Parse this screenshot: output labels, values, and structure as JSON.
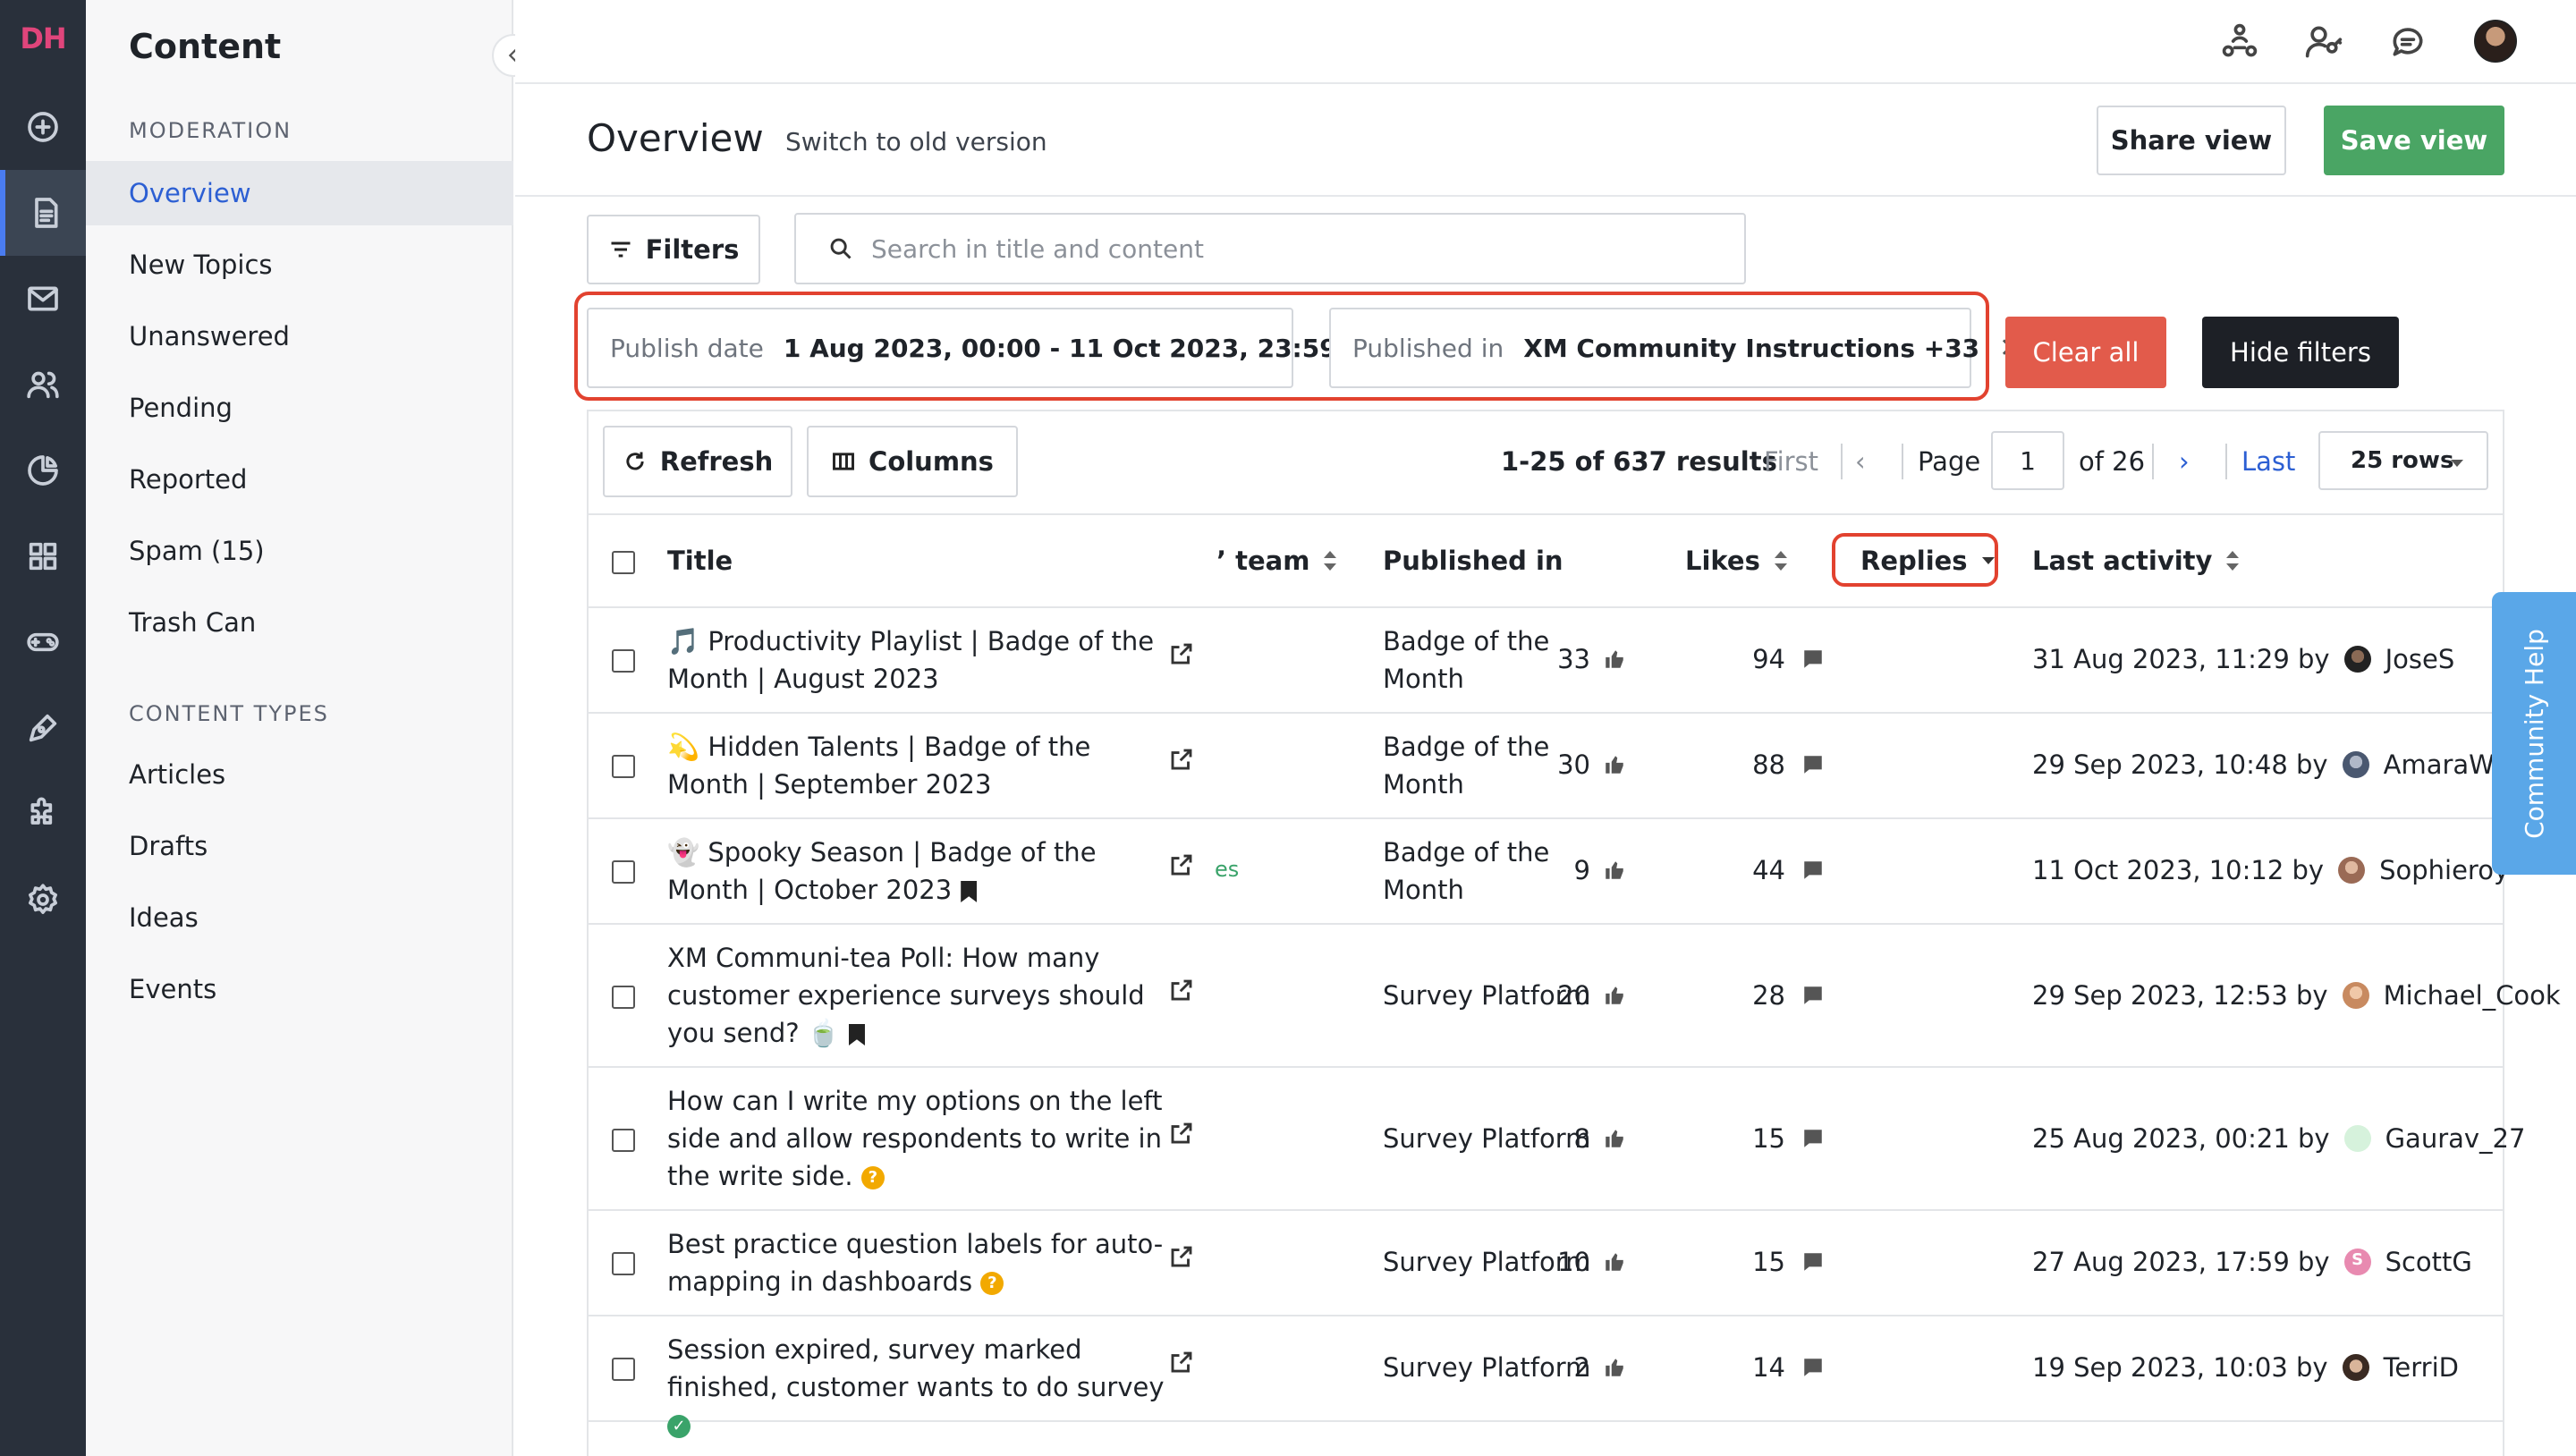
{
  "rail": {
    "logo": "DH"
  },
  "sidebar": {
    "title": "Content",
    "section_moderation": "MODERATION",
    "moderation_items": [
      "Overview",
      "New Topics",
      "Unanswered",
      "Pending",
      "Reported",
      "Spam (15)",
      "Trash Can"
    ],
    "section_types": "CONTENT TYPES",
    "type_items": [
      "Articles",
      "Drafts",
      "Ideas",
      "Events"
    ]
  },
  "header": {
    "title": "Overview",
    "old_version": "Switch to old version",
    "share": "Share view",
    "save": "Save view"
  },
  "filters": {
    "button": "Filters",
    "search_placeholder": "Search in title and content",
    "chip1_label": "Publish date",
    "chip1_value": "1 Aug 2023, 00:00 - 11 Oct 2023, 23:59",
    "chip2_label": "Published in",
    "chip2_value": "XM Community Instructions +33",
    "clear": "Clear all",
    "hide": "Hide filters"
  },
  "toolbar": {
    "refresh": "Refresh",
    "columns": "Columns",
    "results": "1-25 of 637 results",
    "first": "First",
    "page_label": "Page",
    "page_value": "1",
    "of": "of 26",
    "last": "Last",
    "rows": "25 rows"
  },
  "columns": {
    "title": "Title",
    "team": "’ team",
    "published_in": "Published in",
    "likes": "Likes",
    "replies": "Replies",
    "last_activity": "Last activity"
  },
  "rows": [
    {
      "title": "🎵 Productivity Playlist | Badge of the Month | August 2023",
      "pub": "Badge of the Month",
      "likes": "33",
      "replies": "94",
      "activity": "31 Aug 2023, 11:29 by",
      "user": "JoseS"
    },
    {
      "title": "💫 Hidden Talents | Badge of the Month | September 2023",
      "pub": "Badge of the Month",
      "likes": "30",
      "replies": "88",
      "activity": "29 Sep 2023, 10:48 by",
      "user": "AmaraW"
    },
    {
      "title": "👻 Spooky Season | Badge of the Month | October 2023",
      "pub": "Badge of the Month",
      "likes": "9",
      "replies": "44",
      "activity": "11 Oct 2023, 10:12 by",
      "user": "Sophieroy",
      "team_snip": "es"
    },
    {
      "title": "XM Communi-tea Poll: How many customer experience surveys should you send? 🍵",
      "pub": "Survey Platform",
      "likes": "20",
      "replies": "28",
      "activity": "29 Sep 2023, 12:53 by",
      "user": "Michael_Cook"
    },
    {
      "title": "How can I write my options on the left side and allow respondents to write in the write side.",
      "pub": "Survey Platform",
      "likes": "8",
      "replies": "15",
      "activity": "25 Aug 2023, 00:21 by",
      "user": "Gaurav_27"
    },
    {
      "title": "Best practice question labels for auto-mapping in dashboards",
      "pub": "Survey Platform",
      "likes": "10",
      "replies": "15",
      "activity": "27 Aug 2023, 17:59 by",
      "user": "ScottG",
      "user_initial": "S"
    },
    {
      "title": "Session expired, survey marked finished, customer wants to do survey",
      "pub": "Survey Platform",
      "likes": "2",
      "replies": "14",
      "activity": "19 Sep 2023, 10:03 by",
      "user": "TerriD"
    }
  ],
  "help": "Community Help",
  "colors": {
    "accent": "#2c5fd3",
    "save_green": "#4aa564",
    "clear_red": "#e25b4b",
    "highlight_red": "#e2422f",
    "help_blue": "#5aa7e8"
  }
}
